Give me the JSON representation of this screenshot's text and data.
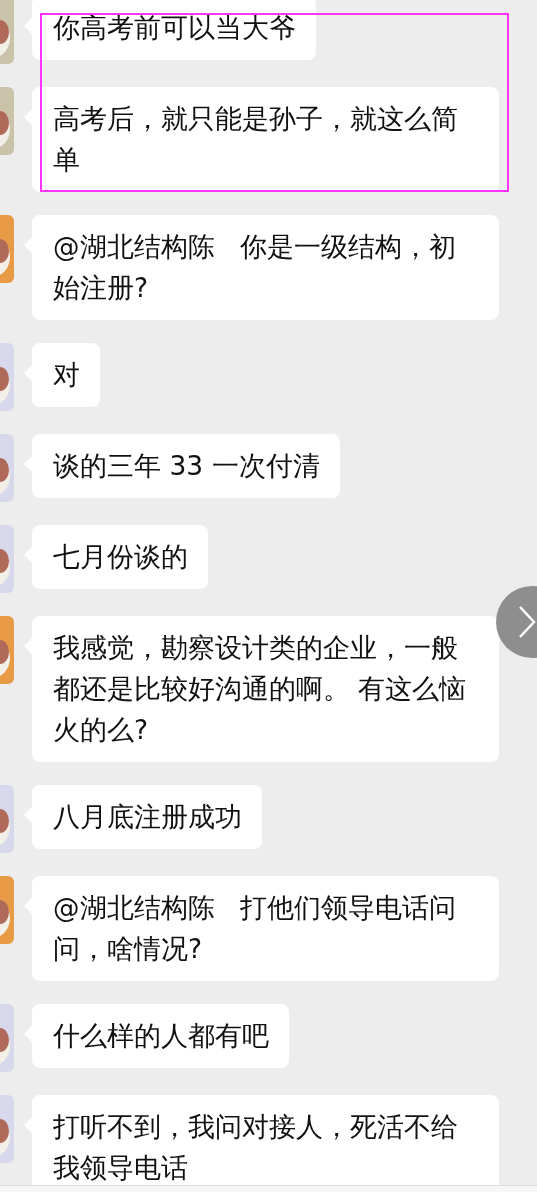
{
  "messages": [
    {
      "avatar": {
        "color": "#cbc2aa"
      },
      "text": "你高考前可以当大爷",
      "highlighted": true
    },
    {
      "avatar": {
        "color": "#cbc2aa"
      },
      "text": "高考后，就只能是孙子，就这么简单",
      "highlighted": true
    },
    {
      "avatar": {
        "color": "#e89a45"
      },
      "text": "@湖北结构陈   你是一级结构，初始注册?",
      "highlighted": false
    },
    {
      "avatar": {
        "color": "#d7d8ec"
      },
      "text": "对",
      "highlighted": false
    },
    {
      "avatar": {
        "color": "#d7d8ec"
      },
      "text": "谈的三年 33 一次付清",
      "highlighted": false
    },
    {
      "avatar": {
        "color": "#d7d8ec"
      },
      "text": "七月份谈的",
      "highlighted": false
    },
    {
      "avatar": {
        "color": "#e89a45"
      },
      "text": "我感觉，勘察设计类的企业，一般都还是比较好沟通的啊。 有这么恼火的么?",
      "highlighted": false
    },
    {
      "avatar": {
        "color": "#d7d8ec"
      },
      "text": "八月底注册成功",
      "highlighted": false
    },
    {
      "avatar": {
        "color": "#e89a45"
      },
      "text": "@湖北结构陈   打他们领导电话问问，啥情况?",
      "highlighted": false
    },
    {
      "avatar": {
        "color": "#d7d8ec"
      },
      "text": "什么样的人都有吧",
      "highlighted": false
    },
    {
      "avatar": {
        "color": "#d7d8ec"
      },
      "text": "打听不到，我问对接人，死活不给我领导电话",
      "highlighted": false
    }
  ]
}
